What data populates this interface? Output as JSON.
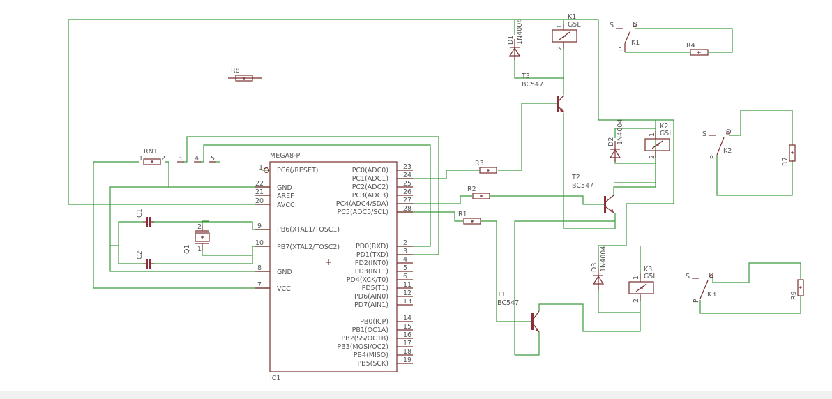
{
  "colors": {
    "wire": "#3a9a3a",
    "part": "#7a2e2e",
    "text": "#555555",
    "background": "#ffffff"
  },
  "mcu": {
    "name": "MEGA8-P",
    "ref": "IC1",
    "left_pins": [
      {
        "num": "1",
        "label": "PC6(/RESET)"
      },
      {
        "num": "22",
        "label": "GND"
      },
      {
        "num": "21",
        "label": "AREF"
      },
      {
        "num": "20",
        "label": "AVCC"
      },
      {
        "num": "9",
        "label": "PB6(XTAL1/TOSC1)"
      },
      {
        "num": "10",
        "label": "PB7(XTAL2/TOSC2)"
      },
      {
        "num": "8",
        "label": "GND"
      },
      {
        "num": "7",
        "label": "VCC"
      }
    ],
    "right_pins": [
      {
        "num": "23",
        "label": "PC0(ADC0)"
      },
      {
        "num": "24",
        "label": "PC1(ADC1)"
      },
      {
        "num": "25",
        "label": "PC2(ADC2)"
      },
      {
        "num": "26",
        "label": "PC3(ADC3)"
      },
      {
        "num": "27",
        "label": "PC4(ADC4/SDA)"
      },
      {
        "num": "28",
        "label": "PC5(ADC5/SCL)"
      },
      {
        "num": "2",
        "label": "PD0(RXD)"
      },
      {
        "num": "3",
        "label": "PD1(TXD)"
      },
      {
        "num": "4",
        "label": "PD2(INT0)"
      },
      {
        "num": "5",
        "label": "PD3(INT1)"
      },
      {
        "num": "6",
        "label": "PD4(XCK/T0)"
      },
      {
        "num": "11",
        "label": "PD5(T1)"
      },
      {
        "num": "12",
        "label": "PD6(AIN0)"
      },
      {
        "num": "13",
        "label": "PD7(AIN1)"
      },
      {
        "num": "14",
        "label": "PB0(ICP)"
      },
      {
        "num": "15",
        "label": "PB1(OC1A)"
      },
      {
        "num": "16",
        "label": "PB2(SS/OC1B)"
      },
      {
        "num": "17",
        "label": "PB3(MOSI/OC2)"
      },
      {
        "num": "18",
        "label": "PB4(MISO)"
      },
      {
        "num": "19",
        "label": "PB5(SCK)"
      }
    ]
  },
  "resistors": {
    "r1": "R1",
    "r2": "R2",
    "r3": "R3",
    "r4": "R4",
    "r7": "R7",
    "r8": "R8",
    "r9": "R9",
    "rn1": "RN1",
    "rn1_pin1": "1",
    "rn1_pin2": "2"
  },
  "header_pins": [
    "3",
    "4",
    "5"
  ],
  "capacitors": {
    "c1": "C1",
    "c2": "C2"
  },
  "crystal": {
    "ref": "Q1",
    "pin1": "1",
    "pin2": "2"
  },
  "transistors": {
    "t1": {
      "ref": "T1",
      "type": "BC547"
    },
    "t2": {
      "ref": "T2",
      "type": "BC547"
    },
    "t3": {
      "ref": "T3",
      "type": "BC547"
    }
  },
  "diodes": {
    "d1": {
      "ref": "D1",
      "type": "1N4004"
    },
    "d2": {
      "ref": "D2",
      "type": "1N4004"
    },
    "d3": {
      "ref": "D3",
      "type": "1N4004"
    }
  },
  "relays": {
    "k1": {
      "ref": "K1",
      "type": "G5L",
      "pin1": "1",
      "pin2": "2"
    },
    "k2": {
      "ref": "K2",
      "type": "G5L",
      "pin1": "1",
      "pin2": "2"
    },
    "k3": {
      "ref": "K3",
      "type": "G5L",
      "pin1": "1",
      "pin2": "2"
    }
  },
  "switches": {
    "k1": {
      "ref": "K1",
      "s": "S",
      "o": "O",
      "p": "P"
    },
    "k2": {
      "ref": "K2",
      "s": "S",
      "o": "O",
      "p": "P"
    },
    "k3": {
      "ref": "K3",
      "s": "S",
      "o": "O",
      "p": "P"
    }
  }
}
